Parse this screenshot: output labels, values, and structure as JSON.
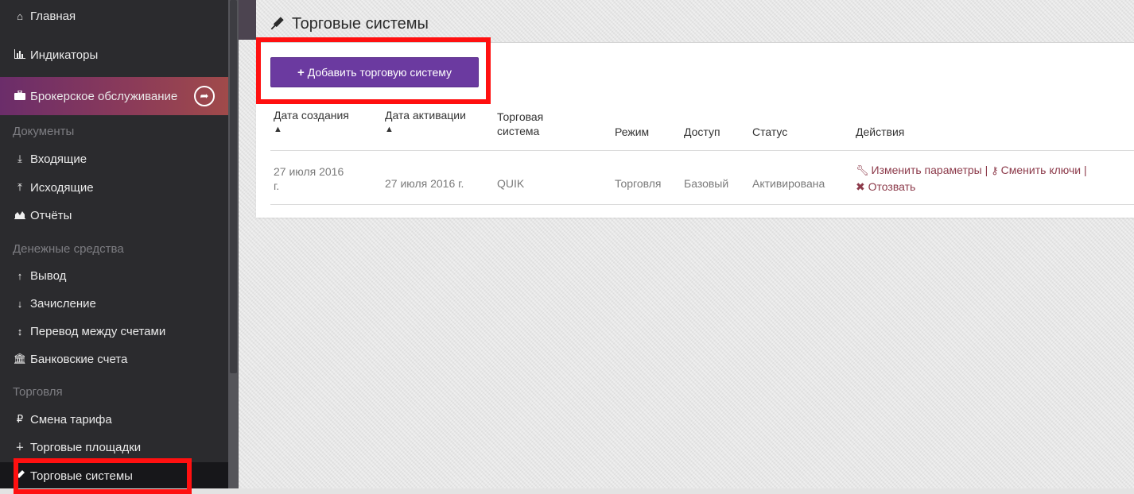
{
  "sidebar": {
    "items": {
      "home": "Главная",
      "indicators": "Индикаторы",
      "broker": "Брокерское обслуживание",
      "incoming": "Входящие",
      "outgoing": "Исходящие",
      "reports": "Отчёты",
      "withdraw": "Вывод",
      "deposit": "Зачисление",
      "transfer": "Перевод между счетами",
      "bank_accounts": "Банковские счета",
      "tariff": "Смена тарифа",
      "platforms": "Торговые площадки",
      "trading_systems": "Торговые системы"
    },
    "sections": {
      "documents": "Документы",
      "money": "Денежные средства",
      "trading": "Торговля"
    }
  },
  "page": {
    "title": "Торговые системы",
    "add_button": "Добавить торговую систему"
  },
  "table": {
    "headers": {
      "created": "Дата создания",
      "activated": "Дата активации",
      "system_l1": "Торговая",
      "system_l2": "система",
      "mode": "Режим",
      "access": "Доступ",
      "status": "Статус",
      "actions": "Действия"
    },
    "rows": [
      {
        "created_l1": "27 июля 2016",
        "created_l2": "г.",
        "activated": "27 июля 2016 г.",
        "system": "QUIK",
        "mode": "Торговля",
        "access": "Базовый",
        "status": "Активирована",
        "action_edit": "Изменить параметры",
        "action_keys": "Сменить ключи",
        "action_revoke": "Отозвать"
      }
    ]
  },
  "colors": {
    "accent": "#6b3aa0",
    "highlight": "#ff1010",
    "sidebar_bg": "#2b2b2e",
    "action_link": "#8c3a4a"
  }
}
